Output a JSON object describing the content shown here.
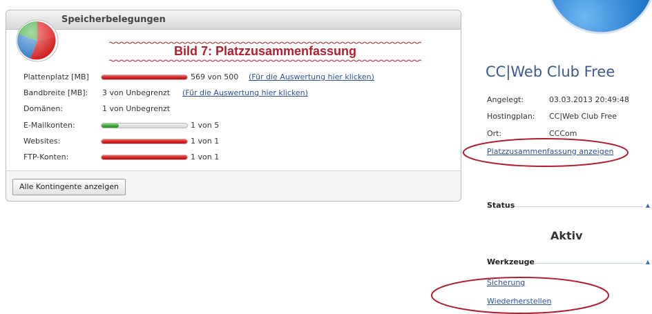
{
  "panel": {
    "title": "Speicherbelegungen",
    "annotation": "Bild 7: Platzzusammenfassung",
    "rows": [
      {
        "label": "Plattenplatz [MB]",
        "value": "569 von 500",
        "link": "(Für die Auswertung hier klicken)",
        "usage": 1.0,
        "bar": "red"
      },
      {
        "label": "Bandbreite [MB]:",
        "value": "3 von Unbegrenzt",
        "link": "(Für die Auswertung hier klicken)"
      },
      {
        "label": "Domänen:",
        "value": "1 von Unbegrenzt"
      },
      {
        "label": "E-Mailkonten:",
        "value": "1 von 5",
        "usage": 0.2,
        "bar": "green"
      },
      {
        "label": "Websites:",
        "value": "1 von 1",
        "usage": 1.0,
        "bar": "red"
      },
      {
        "label": "FTP-Konten:",
        "value": "1 von 1",
        "usage": 1.0,
        "bar": "red"
      }
    ],
    "button_label": "Alle Kontingente anzeigen"
  },
  "plan": {
    "title": "CC|Web Club Free",
    "info": [
      {
        "key": "Angelegt:",
        "value": "03.03.2013 20:49:48"
      },
      {
        "key": "Hostingplan:",
        "value": "CC|Web Club Free"
      },
      {
        "key": "Ort:",
        "value": "CCCom"
      }
    ],
    "summary_link": "Platzzusammenfassung anzeigen"
  },
  "status": {
    "heading": "Status",
    "value": "Aktiv"
  },
  "tools": {
    "heading": "Werkzeuge",
    "items": [
      "Sicherung",
      "Wiederherstellen"
    ]
  },
  "colors": {
    "link": "#2a4fa1",
    "annotation": "#b41d2e",
    "brand_blue": "#3c5a8e",
    "bar_red": "#d51f1f",
    "bar_green": "#3da635"
  }
}
